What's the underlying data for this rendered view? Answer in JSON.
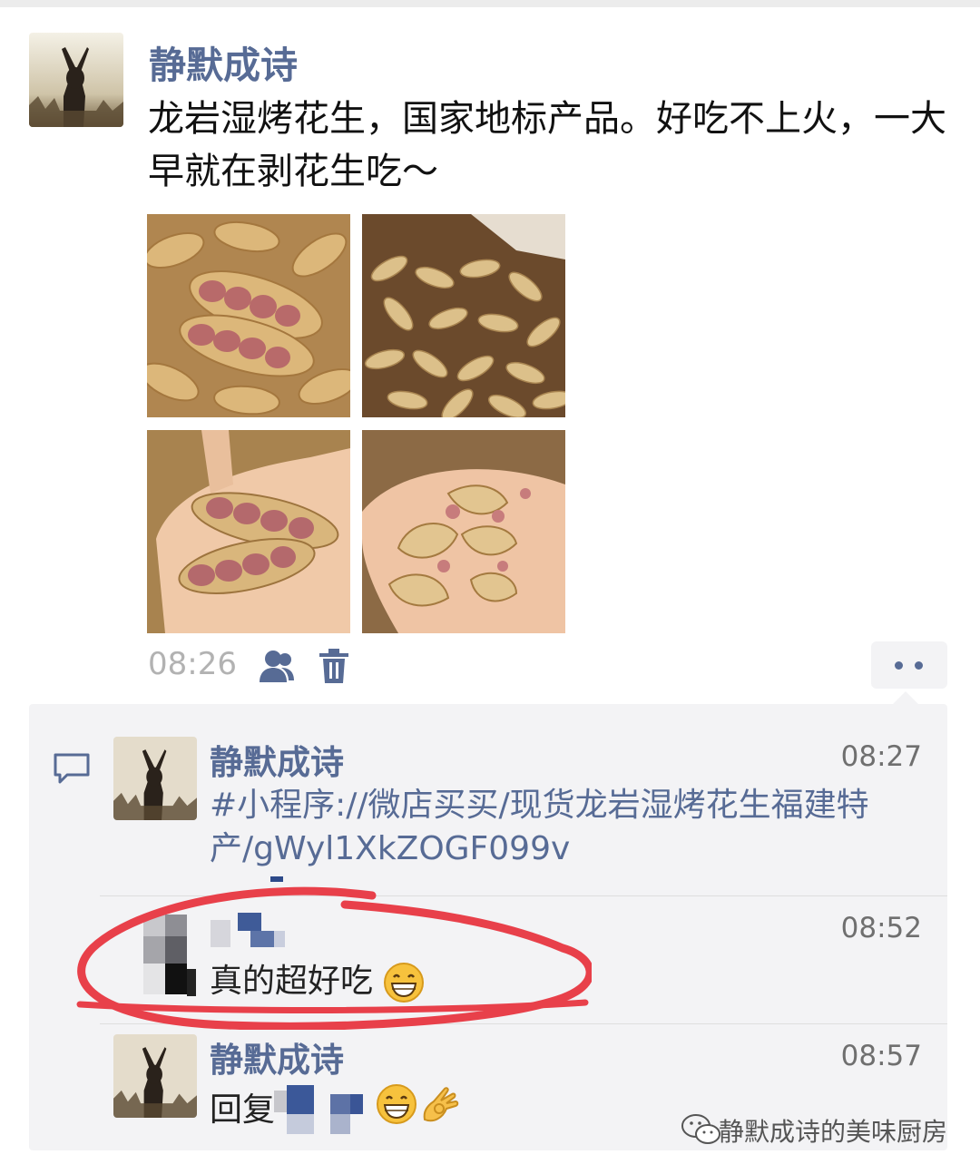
{
  "post": {
    "author": "静默成诗",
    "text": "龙岩湿烤花生，国家地标产品。好吃不上火，一大早就在剥花生吃～",
    "time": "08:26",
    "privacy_icon": "friends-icon",
    "delete_icon": "trash-icon",
    "more_icon": "more-dots-icon"
  },
  "comments": [
    {
      "author": "静默成诗",
      "time": "08:27",
      "text": "#小程序://微店买买/现货龙岩湿烤花生福建特产/gWyl1XkZOGF099v"
    },
    {
      "author": "",
      "time": "08:52",
      "text": "真的超好吃",
      "emoji": "grinning-face"
    },
    {
      "author": "静默成诗",
      "time": "08:57",
      "text": "回复",
      "emoji": [
        "grinning-face",
        "ok-hand"
      ]
    }
  ],
  "watermark": {
    "text": "静默成诗的美味厨房",
    "icon": "wechat-icon"
  },
  "colors": {
    "name": "#576b95",
    "comment_bg": "#f3f3f5",
    "highlight_circle": "#e8404a"
  }
}
